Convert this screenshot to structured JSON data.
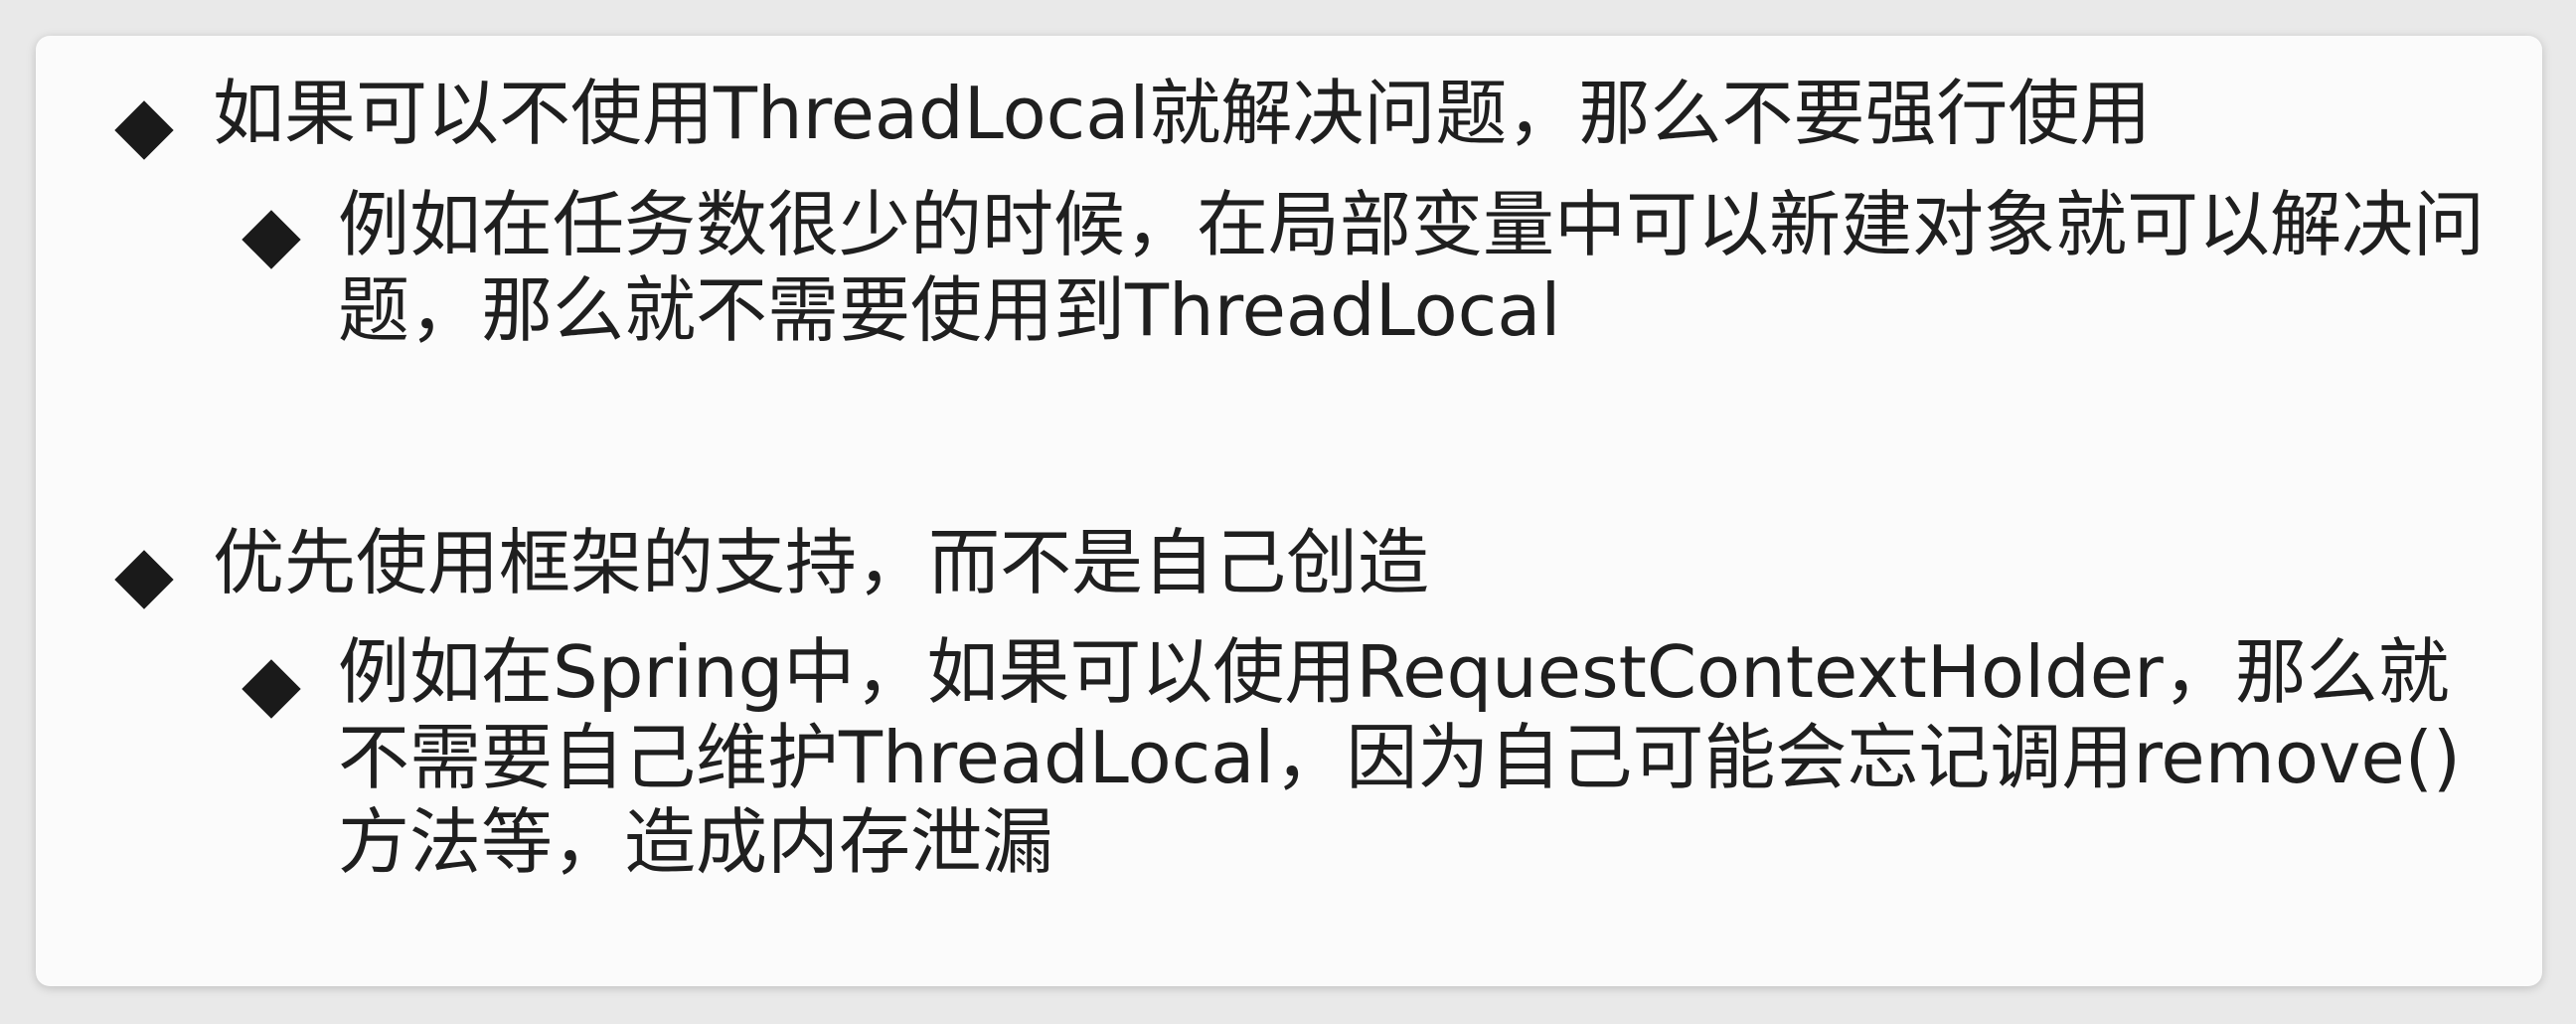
{
  "slide": {
    "bullets": [
      {
        "text": "如果可以不使用ThreadLocal就解决问题，那么不要强行使用",
        "sub": "例如在任务数很少的时候，在局部变量中可以新建对象就可以解决问题，那么就不需要使用到ThreadLocal"
      },
      {
        "text": "优先使用框架的支持，而不是自己创造",
        "sub": "例如在Spring中，如果可以使用RequestContextHolder，那么就不需要自己维护ThreadLocal，因为自己可能会忘记调用remove()方法等，造成内存泄漏"
      }
    ]
  }
}
